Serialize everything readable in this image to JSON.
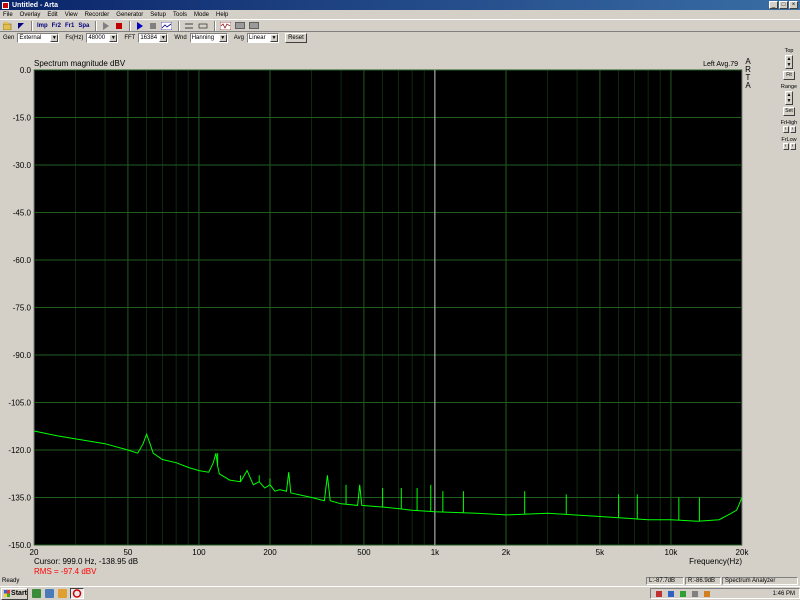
{
  "window": {
    "title": "Untitled - Arta"
  },
  "menu": [
    "File",
    "Overlay",
    "Edit",
    "View",
    "Recorder",
    "Generator",
    "Setup",
    "Tools",
    "Mode",
    "Help"
  ],
  "toolbar": {
    "imp_label": "Imp",
    "fr2_label": "Fr2",
    "fr1_label": "Fr1",
    "spa_label": "Spa"
  },
  "settings": {
    "gen_label": "Gen",
    "gen_value": "External",
    "fs_label": "Fs(Hz)",
    "fs_value": "48000",
    "fft_label": "FFT",
    "fft_value": "16384",
    "wnd_label": "Wnd",
    "wnd_value": "Hanning",
    "avg_label": "Avg",
    "avg_value": "Linear",
    "reset_label": "Reset"
  },
  "right_panel": {
    "top_label": "Top",
    "fit_label": "Fit",
    "range_label": "Range",
    "set_label": "Set",
    "frhigh_label": "FrHigh",
    "frlow_label": "FrLow"
  },
  "chart_data": {
    "type": "line",
    "title": "Spectrum magnitude dBV",
    "header_right": "Left  Avg.79",
    "brand_label": "A R T A",
    "xlabel": "Frequency(Hz)",
    "ylabel": "",
    "x_scale": "log",
    "xlim": [
      20,
      20000
    ],
    "ylim": [
      -150,
      0
    ],
    "x_ticks": [
      20,
      50,
      100,
      200,
      500,
      1000,
      2000,
      5000,
      10000,
      20000
    ],
    "x_tick_labels": [
      "20",
      "50",
      "100",
      "200",
      "500",
      "1k",
      "2k",
      "5k",
      "10k",
      "20k"
    ],
    "y_ticks": [
      0,
      -15,
      -30,
      -45,
      -60,
      -75,
      -90,
      -105,
      -120,
      -135,
      -150
    ],
    "y_tick_labels": [
      "0.0",
      "-15.0",
      "-30.0",
      "-45.0",
      "-60.0",
      "-75.0",
      "-90.0",
      "-105.0",
      "-120.0",
      "-135.0",
      "-150.0"
    ],
    "grid": true,
    "cursor_x": 999.0,
    "series": [
      {
        "color": "#00ff00",
        "x": [
          20,
          25,
          30,
          40,
          50,
          55,
          58,
          60,
          62,
          64,
          70,
          80,
          90,
          100,
          110,
          115,
          118,
          120,
          122,
          125,
          135,
          150,
          160,
          170,
          180,
          190,
          200,
          210,
          220,
          235,
          240,
          245,
          260,
          300,
          340,
          350,
          360,
          400,
          470,
          480,
          490,
          600,
          700,
          800,
          1000,
          1500,
          2000,
          3000,
          5000,
          8000,
          10000,
          13000,
          16000,
          18000,
          19000,
          20000
        ],
        "y": [
          -114,
          -115.5,
          -116.5,
          -118,
          -120,
          -121,
          -118,
          -115,
          -118,
          -121,
          -123,
          -124,
          -125.5,
          -126.5,
          -127,
          -124,
          -121,
          -125,
          -127.5,
          -128,
          -129.5,
          -130,
          -126.5,
          -131,
          -130,
          -132,
          -131,
          -133,
          -132.5,
          -133,
          -127,
          -133.5,
          -134,
          -135,
          -136,
          -128,
          -136,
          -137,
          -137.5,
          -131,
          -137.5,
          -138,
          -138.5,
          -139,
          -139.5,
          -140,
          -140.5,
          -140,
          -141,
          -142,
          -142,
          -142.5,
          -142,
          -140,
          -139,
          -135
        ]
      }
    ],
    "spurs": [
      {
        "x": 60,
        "y": -115
      },
      {
        "x": 120,
        "y": -121
      },
      {
        "x": 150,
        "y": -128
      },
      {
        "x": 160,
        "y": -126.5
      },
      {
        "x": 180,
        "y": -128
      },
      {
        "x": 200,
        "y": -129
      },
      {
        "x": 240,
        "y": -127
      },
      {
        "x": 350,
        "y": -128
      },
      {
        "x": 420,
        "y": -131
      },
      {
        "x": 480,
        "y": -131
      },
      {
        "x": 600,
        "y": -132
      },
      {
        "x": 720,
        "y": -132
      },
      {
        "x": 840,
        "y": -132
      },
      {
        "x": 960,
        "y": -131
      },
      {
        "x": 1080,
        "y": -133
      },
      {
        "x": 1320,
        "y": -133
      },
      {
        "x": 2400,
        "y": -133
      },
      {
        "x": 3600,
        "y": -134
      },
      {
        "x": 6000,
        "y": -134
      },
      {
        "x": 7200,
        "y": -134
      },
      {
        "x": 10800,
        "y": -135
      },
      {
        "x": 13200,
        "y": -135
      }
    ]
  },
  "cursor_readout": {
    "cursor_text": "Cursor:   999.0 Hz, -138.95 dB",
    "rms_text": "RMS =  -97.4 dBV"
  },
  "status": {
    "ready": "Ready",
    "left_level": "L:-87.7dB",
    "right_level": "R:-86.9dB",
    "mode": "Spectrum Analyzer"
  },
  "taskbar": {
    "start_label": "Start",
    "clock": "1:46 PM"
  },
  "colors": {
    "plot_bg": "#000000",
    "grid": "#1f5c1f",
    "trace": "#00ff00",
    "cursor": "#c0c0c0",
    "rms_text": "#ff0000"
  }
}
